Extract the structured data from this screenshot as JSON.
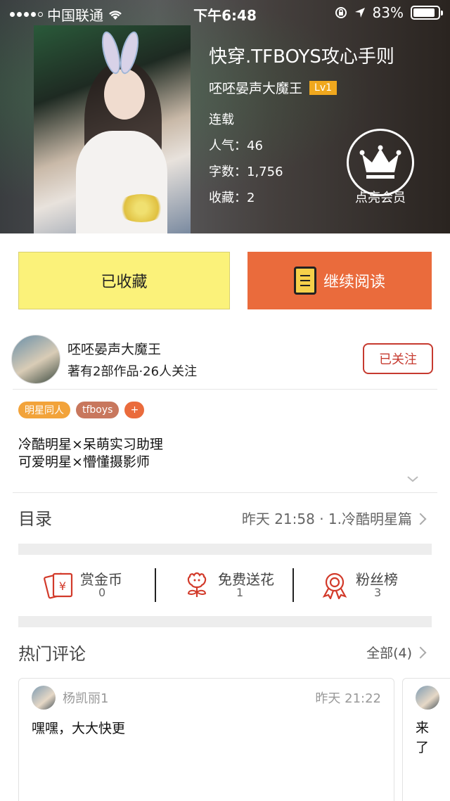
{
  "status_bar": {
    "carrier": "中国联通",
    "time": "下午6:48",
    "battery": "83%"
  },
  "book": {
    "title": "快穿.TFBOYS攻心手则",
    "author": "呸呸晏声大魔王",
    "level": "Lv1",
    "status": "连载",
    "popularity": "人气：46",
    "word_count": "字数：1,756",
    "favorites": "收藏：2"
  },
  "vip": {
    "label": "点亮会员"
  },
  "buttons": {
    "favorited": "已收藏",
    "continue_reading": "继续阅读"
  },
  "author_card": {
    "name": "呸呸晏声大魔王",
    "stats": "著有2部作品·26人关注",
    "follow_label": "已关注"
  },
  "tags": [
    "明星同人",
    "tfboys",
    "+"
  ],
  "description": [
    "冷酷明星×呆萌实习助理",
    "可爱明星×懵懂摄影师"
  ],
  "toc": {
    "label": "目录",
    "latest": "昨天 21:58 · 1.冷酷明星篇"
  },
  "actions": [
    {
      "label": "赏金币",
      "value": "0",
      "icon": "coin-envelope-icon"
    },
    {
      "label": "免费送花",
      "value": "1",
      "icon": "flower-icon"
    },
    {
      "label": "粉丝榜",
      "value": "3",
      "icon": "medal-icon"
    }
  ],
  "comments_section": {
    "label": "热门评论",
    "all_label": "全部(4)"
  },
  "comments": [
    {
      "user": "杨凯丽1",
      "time": "昨天 21:22",
      "text": "嘿嘿，大大快更"
    },
    {
      "text": "来了"
    }
  ],
  "colors": {
    "accent_orange": "#ea6b3c",
    "favorited_yellow": "#fbf27a",
    "follow_red": "#c63a2f",
    "level_badge": "#f0a81e"
  }
}
